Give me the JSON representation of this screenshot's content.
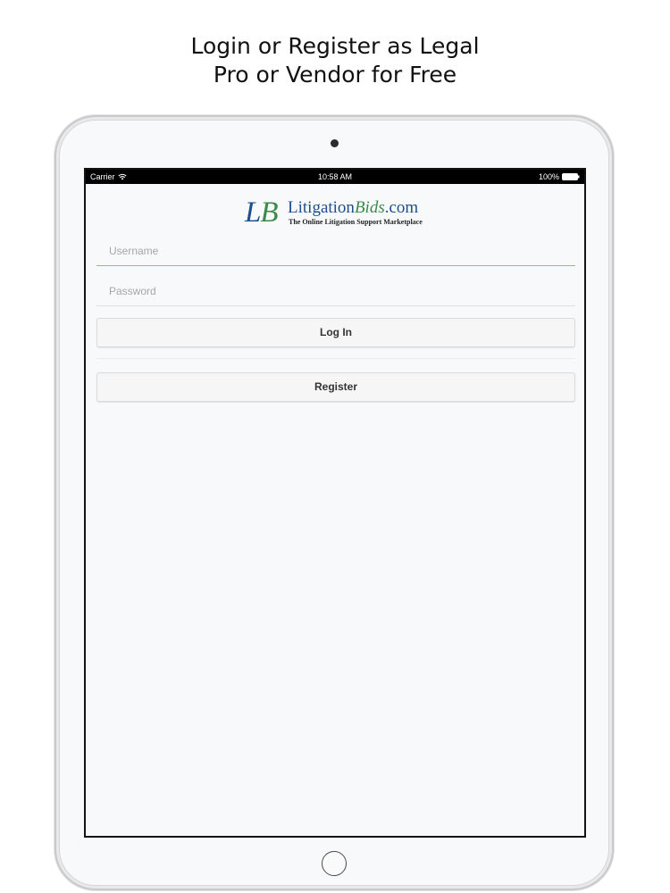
{
  "headline": {
    "line1": "Login or Register as Legal",
    "line2": "Pro or Vendor for Free"
  },
  "status_bar": {
    "carrier": "Carrier",
    "time": "10:58 AM",
    "battery": "100%",
    "icons": [
      "wifi-icon",
      "battery-icon"
    ]
  },
  "logo": {
    "mark_l": "L",
    "mark_b": "B",
    "name_part1": "Litigation",
    "name_part2": "Bids",
    "name_part3": ".com",
    "tagline": "The Online Litigation Support Marketplace",
    "colors": {
      "blue": "#1b4f8f",
      "green": "#3a8a4a"
    }
  },
  "form": {
    "username_placeholder": "Username",
    "password_placeholder": "Password",
    "login_label": "Log In",
    "register_label": "Register",
    "focus_color": "#8ec07c"
  }
}
